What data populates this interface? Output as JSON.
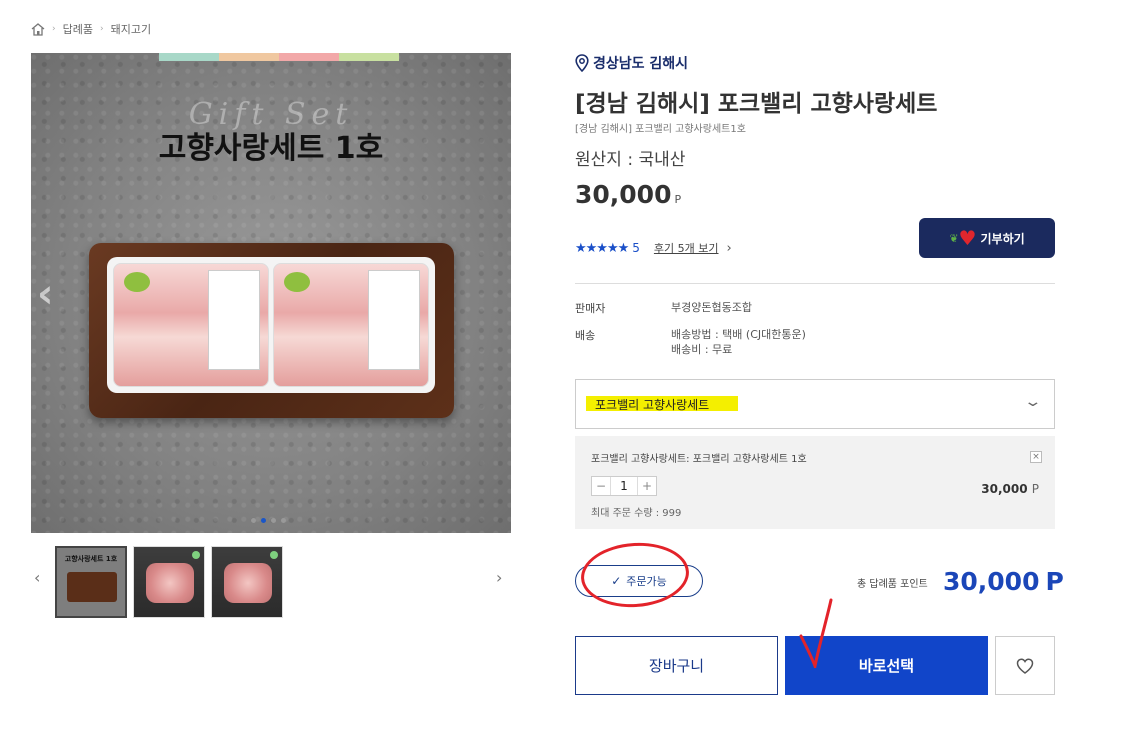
{
  "breadcrumb": {
    "home_icon": "home-icon",
    "items": [
      "답례품",
      "돼지고기"
    ]
  },
  "gallery": {
    "main_title": "고향사랑세트 1호",
    "script_text": "Gift Set",
    "strip_colors": [
      "#a8d8c8",
      "#f0c8a0",
      "#f2a8a8",
      "#c8e0a0"
    ],
    "thumb_title": "고향사랑세트 1호"
  },
  "product": {
    "location": "경상남도 김해시",
    "title": "[경남 김해시] 포크밸리 고향사랑세트",
    "subtitle": "[경남 김해시] 포크밸리 고향사랑세트1호",
    "origin": "원산지 : 국내산",
    "price": "30,000",
    "price_unit": "P",
    "rating_stars": "★★★★★",
    "rating_count": "5",
    "review_link": "후기 5개 보기",
    "donate_label": "기부하기"
  },
  "info": {
    "seller_label": "판매자",
    "seller_value": "부경양돈협동조합",
    "shipping_label": "배송",
    "shipping_method": "배송방법 : 택배 (CJ대한통운)",
    "shipping_fee": "배송비 : 무료"
  },
  "option_select": {
    "selected": "포크밸리 고향사랑세트"
  },
  "option_item": {
    "name": "포크밸리 고향사랑세트: 포크밸리 고향사랑세트 1호",
    "quantity": "1",
    "minus": "−",
    "plus": "+",
    "price": "30,000",
    "price_unit": "P",
    "max_qty": "최대 주문 수량 : 999"
  },
  "order": {
    "status": "주문가능",
    "total_label": "총 답례품 포인트",
    "total_value": "30,000",
    "total_unit": "P"
  },
  "actions": {
    "cart": "장바구니",
    "buy": "바로선택"
  },
  "colors": {
    "primary": "#1145c9",
    "navy": "#1b2a5e",
    "annotation_red": "#e3232a",
    "highlight": "#f4ef00"
  }
}
